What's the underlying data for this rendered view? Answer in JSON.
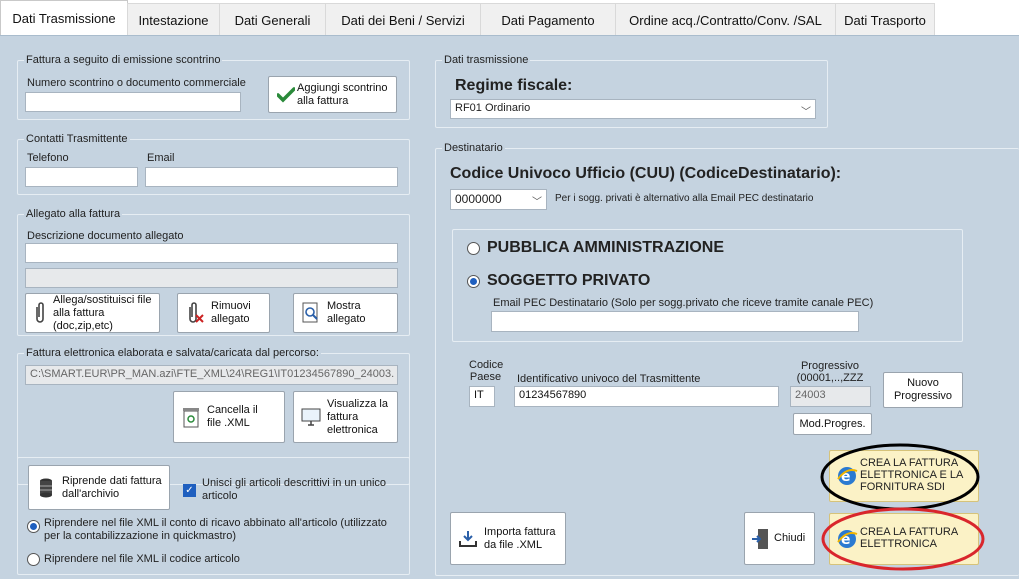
{
  "tabs": [
    "Dati Trasmissione",
    "Intestazione",
    "Dati Generali",
    "Dati dei Beni / Servizi",
    "Dati Pagamento",
    "Ordine acq./Contratto/Conv. /SAL",
    "Dati Trasporto"
  ],
  "scontrino": {
    "legend": "Fattura a seguito di emissione scontrino",
    "label": "Numero scontrino o documento commerciale",
    "value": "",
    "button": "Aggiungi scontrino alla fattura"
  },
  "contatti": {
    "legend": "Contatti Trasmittente",
    "telefono_label": "Telefono",
    "telefono_value": "",
    "email_label": "Email",
    "email_value": ""
  },
  "allegato": {
    "legend": "Allegato alla fattura",
    "descr_label": "Descrizione documento allegato",
    "descr_value": "",
    "file_value": "",
    "btn_allega": "Allega/sostituisci file alla fattura (doc,zip,etc)",
    "btn_rimuovi": "Rimuovi allegato",
    "btn_mostra": "Mostra allegato"
  },
  "percorso": {
    "legend": "Fattura elettronica elaborata e salvata/caricata dal percorso:",
    "value": "C:\\SMART.EUR\\PR_MAN.azi\\FTE_XML\\24\\REG1\\IT01234567890_24003.",
    "btn_cancella": "Cancella il file .XML",
    "btn_visualizza": "Visualizza la fattura elettronica"
  },
  "archivio": {
    "btn_riprende": "Riprende dati fattura dall'archivio",
    "check_unisci": "Unisci gli articoli descrittivi in un unico articolo",
    "radio1": "Riprendere nel file XML il  conto di ricavo abbinato all'articolo (utilizzato per la contabilizzazione in quickmastro)",
    "radio2": "Riprendere nel file XML il codice articolo"
  },
  "trasmissione": {
    "legend": "Dati trasmissione",
    "regime_label": "Regime fiscale:",
    "regime_value": "RF01 Ordinario"
  },
  "destinatario": {
    "legend": "Destinatario",
    "cuu_label": "Codice Univoco Ufficio (CUU) (CodiceDestinatario):",
    "cuu_value": "0000000",
    "cuu_note": "Per i sogg. privati è alternativo alla Email PEC destinatario",
    "radio_pa": "PUBBLICA AMMINISTRAZIONE",
    "radio_privato": "SOGGETTO PRIVATO",
    "pec_label": "Email PEC Destinatario (Solo per sogg.privato che riceve tramite canale PEC)",
    "pec_value": "",
    "paese_label": "Codice Paese",
    "paese_value": "IT",
    "id_label": "Identificativo univoco del Trasmittente",
    "id_value": "01234567890",
    "progr_label": "Progressivo (00001,..,ZZZ",
    "progr_value": "24003",
    "btn_nuovo": "Nuovo Progressivo",
    "btn_mod": "Mod.Progres."
  },
  "actions": {
    "btn_importa": "Importa fattura da file .XML",
    "btn_chiudi": "Chiudi",
    "btn_crea_sdi": "CREA LA FATTURA ELETTRONICA E LA FORNITURA SDI",
    "btn_crea": "CREA LA FATTURA ELETTRONICA"
  },
  "colors": {
    "panel": "#c5d3e0",
    "accent": "#1f5fbf",
    "highlight_black": "#000000",
    "highlight_red": "#d9262c"
  }
}
